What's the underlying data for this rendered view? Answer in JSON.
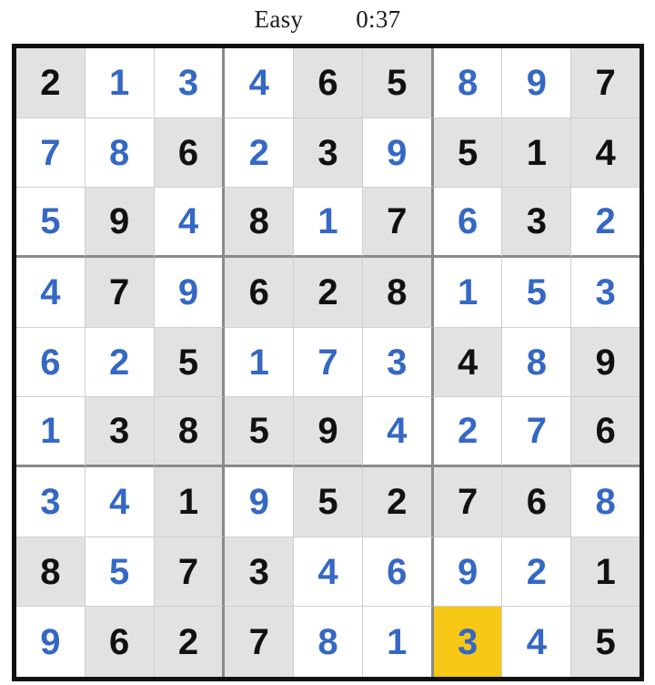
{
  "header": {
    "difficulty": "Easy",
    "timer": "0:37"
  },
  "colors": {
    "given_digit": "#111111",
    "entered_digit": "#3568c4",
    "given_cell_background": "#e2e2e2",
    "entered_cell_background": "#ffffff",
    "selected_cell_background": "#f7c815",
    "outer_border": "#111111",
    "block_divider": "#8a8a8a",
    "cell_divider": "#cfcfcf"
  },
  "board": {
    "size": 9,
    "selected_cell": {
      "row": 9,
      "col": 7,
      "value": "3"
    },
    "rows": [
      [
        {
          "value": "2",
          "style": "given"
        },
        {
          "value": "1",
          "style": "entered"
        },
        {
          "value": "3",
          "style": "entered"
        },
        {
          "value": "4",
          "style": "entered"
        },
        {
          "value": "6",
          "style": "given"
        },
        {
          "value": "5",
          "style": "given"
        },
        {
          "value": "8",
          "style": "entered"
        },
        {
          "value": "9",
          "style": "entered"
        },
        {
          "value": "7",
          "style": "given"
        }
      ],
      [
        {
          "value": "7",
          "style": "entered"
        },
        {
          "value": "8",
          "style": "entered"
        },
        {
          "value": "6",
          "style": "given"
        },
        {
          "value": "2",
          "style": "entered"
        },
        {
          "value": "3",
          "style": "given"
        },
        {
          "value": "9",
          "style": "entered"
        },
        {
          "value": "5",
          "style": "given"
        },
        {
          "value": "1",
          "style": "given"
        },
        {
          "value": "4",
          "style": "given"
        }
      ],
      [
        {
          "value": "5",
          "style": "entered"
        },
        {
          "value": "9",
          "style": "given"
        },
        {
          "value": "4",
          "style": "entered"
        },
        {
          "value": "8",
          "style": "given"
        },
        {
          "value": "1",
          "style": "entered"
        },
        {
          "value": "7",
          "style": "given"
        },
        {
          "value": "6",
          "style": "entered"
        },
        {
          "value": "3",
          "style": "given"
        },
        {
          "value": "2",
          "style": "entered"
        }
      ],
      [
        {
          "value": "4",
          "style": "entered"
        },
        {
          "value": "7",
          "style": "given"
        },
        {
          "value": "9",
          "style": "entered"
        },
        {
          "value": "6",
          "style": "given"
        },
        {
          "value": "2",
          "style": "given"
        },
        {
          "value": "8",
          "style": "given"
        },
        {
          "value": "1",
          "style": "entered"
        },
        {
          "value": "5",
          "style": "entered"
        },
        {
          "value": "3",
          "style": "entered"
        }
      ],
      [
        {
          "value": "6",
          "style": "entered"
        },
        {
          "value": "2",
          "style": "entered"
        },
        {
          "value": "5",
          "style": "given"
        },
        {
          "value": "1",
          "style": "entered"
        },
        {
          "value": "7",
          "style": "entered"
        },
        {
          "value": "3",
          "style": "entered"
        },
        {
          "value": "4",
          "style": "given"
        },
        {
          "value": "8",
          "style": "entered"
        },
        {
          "value": "9",
          "style": "given"
        }
      ],
      [
        {
          "value": "1",
          "style": "entered"
        },
        {
          "value": "3",
          "style": "given"
        },
        {
          "value": "8",
          "style": "given"
        },
        {
          "value": "5",
          "style": "given"
        },
        {
          "value": "9",
          "style": "given"
        },
        {
          "value": "4",
          "style": "entered"
        },
        {
          "value": "2",
          "style": "entered"
        },
        {
          "value": "7",
          "style": "entered"
        },
        {
          "value": "6",
          "style": "given"
        }
      ],
      [
        {
          "value": "3",
          "style": "entered"
        },
        {
          "value": "4",
          "style": "entered"
        },
        {
          "value": "1",
          "style": "given"
        },
        {
          "value": "9",
          "style": "entered"
        },
        {
          "value": "5",
          "style": "given"
        },
        {
          "value": "2",
          "style": "given"
        },
        {
          "value": "7",
          "style": "given"
        },
        {
          "value": "6",
          "style": "given"
        },
        {
          "value": "8",
          "style": "entered"
        }
      ],
      [
        {
          "value": "8",
          "style": "given"
        },
        {
          "value": "5",
          "style": "entered"
        },
        {
          "value": "7",
          "style": "given"
        },
        {
          "value": "3",
          "style": "given"
        },
        {
          "value": "4",
          "style": "entered"
        },
        {
          "value": "6",
          "style": "entered"
        },
        {
          "value": "9",
          "style": "entered"
        },
        {
          "value": "2",
          "style": "entered"
        },
        {
          "value": "1",
          "style": "given"
        }
      ],
      [
        {
          "value": "9",
          "style": "entered"
        },
        {
          "value": "6",
          "style": "given"
        },
        {
          "value": "2",
          "style": "given"
        },
        {
          "value": "7",
          "style": "given"
        },
        {
          "value": "8",
          "style": "entered"
        },
        {
          "value": "1",
          "style": "entered"
        },
        {
          "value": "3",
          "style": "selected"
        },
        {
          "value": "4",
          "style": "entered"
        },
        {
          "value": "5",
          "style": "given"
        }
      ]
    ]
  }
}
